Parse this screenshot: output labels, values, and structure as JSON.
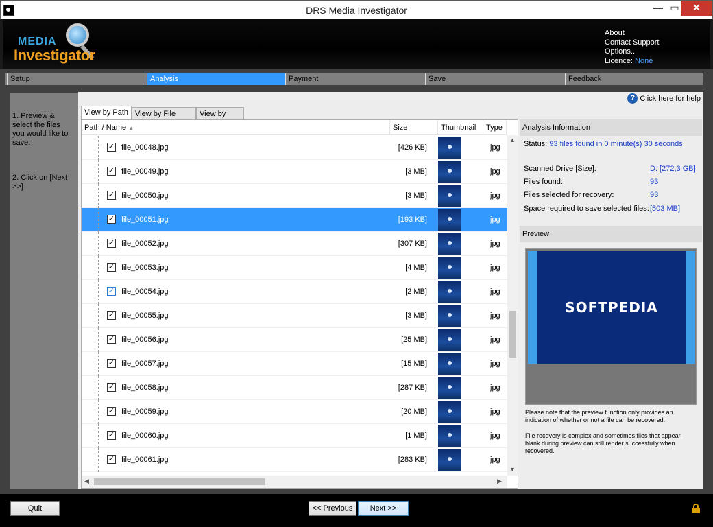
{
  "window": {
    "title": "DRS Media Investigator",
    "close": "✕",
    "icon": "app-icon"
  },
  "header": {
    "logo_top": "MEDIA",
    "logo_bottom": "Investigator",
    "links": {
      "about": "About",
      "contact": "Contact Support",
      "options": "Options...",
      "licence_label": "Licence:",
      "licence_value": "None"
    }
  },
  "nav": {
    "tabs": [
      "Setup",
      "Analysis",
      "Payment",
      "Save",
      "Feedback"
    ],
    "active": "Analysis"
  },
  "instructions": {
    "step1": "1. Preview & select the files you would like to save:",
    "step2": "2. Click on [Next >>]"
  },
  "help": {
    "label": "Click here for help",
    "icon": "?"
  },
  "view_tabs": [
    "View by Path",
    "View by File Type",
    "View by Size"
  ],
  "columns": {
    "path": "Path / Name",
    "size": "Size",
    "thumb": "Thumbnail",
    "type": "Type"
  },
  "files": [
    {
      "name": "file_00048.jpg",
      "size": "[426 KB]",
      "type": "jpg",
      "checked": true
    },
    {
      "name": "file_00049.jpg",
      "size": "[3 MB]",
      "type": "jpg",
      "checked": true
    },
    {
      "name": "file_00050.jpg",
      "size": "[3 MB]",
      "type": "jpg",
      "checked": true
    },
    {
      "name": "file_00051.jpg",
      "size": "[193 KB]",
      "type": "jpg",
      "checked": true,
      "selected": true
    },
    {
      "name": "file_00052.jpg",
      "size": "[307 KB]",
      "type": "jpg",
      "checked": true
    },
    {
      "name": "file_00053.jpg",
      "size": "[4 MB]",
      "type": "jpg",
      "checked": true
    },
    {
      "name": "file_00054.jpg",
      "size": "[2 MB]",
      "type": "jpg",
      "checked": true
    },
    {
      "name": "file_00055.jpg",
      "size": "[3 MB]",
      "type": "jpg",
      "checked": true
    },
    {
      "name": "file_00056.jpg",
      "size": "[25 MB]",
      "type": "jpg",
      "checked": true
    },
    {
      "name": "file_00057.jpg",
      "size": "[15 MB]",
      "type": "jpg",
      "checked": true
    },
    {
      "name": "file_00058.jpg",
      "size": "[287 KB]",
      "type": "jpg",
      "checked": true
    },
    {
      "name": "file_00059.jpg",
      "size": "[20 MB]",
      "type": "jpg",
      "checked": true
    },
    {
      "name": "file_00060.jpg",
      "size": "[1 MB]",
      "type": "jpg",
      "checked": true
    },
    {
      "name": "file_00061.jpg",
      "size": "[283 KB]",
      "type": "jpg",
      "checked": true
    }
  ],
  "analysis": {
    "header": "Analysis Information",
    "status_label": "Status:",
    "status_value": "93 files found in 0 minute(s) 30 seconds",
    "drive_label": "Scanned Drive [Size]:",
    "drive_value": "D:  [272,3 GB]",
    "found_label": "Files found:",
    "found_value": "93",
    "selected_label": "Files selected for recovery:",
    "selected_value": "93",
    "space_label": "Space required to save selected files:",
    "space_value": "[503 MB]"
  },
  "preview": {
    "header": "Preview",
    "image_text": "SOFTPEDIA",
    "note1": "Please note that the preview function only provides an indication of whether or not a file can be recovered.",
    "note2": "File recovery is complex and sometimes files that appear blank during preview can still render successfully when recovered."
  },
  "footer": {
    "quit": "Quit",
    "previous": "<< Previous",
    "next": "Next >>"
  }
}
